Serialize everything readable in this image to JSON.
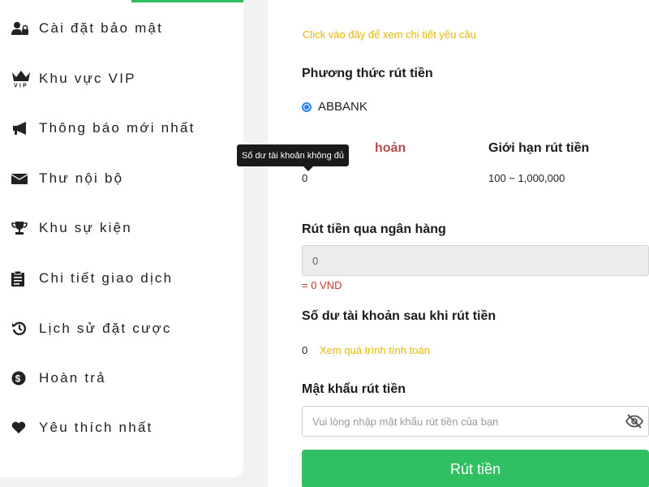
{
  "sidebar": {
    "items": [
      {
        "icon": "user-lock-icon",
        "label": "Cài đặt bảo mật"
      },
      {
        "icon": "vip-crown-icon",
        "label": "Khu vực VIP"
      },
      {
        "icon": "megaphone-icon",
        "label": "Thông báo mới nhất"
      },
      {
        "icon": "envelope-icon",
        "label": "Thư nội bộ"
      },
      {
        "icon": "trophy-icon",
        "label": "Khu sự kiện"
      },
      {
        "icon": "clipboard-icon",
        "label": "Chi tiết giao dịch"
      },
      {
        "icon": "history-icon",
        "label": "Lịch sử đặt cược"
      },
      {
        "icon": "dollar-circle-icon",
        "label": "Hoàn trả"
      },
      {
        "icon": "heart-icon",
        "label": "Yêu thích nhất"
      }
    ]
  },
  "withdraw": {
    "requirements_link": "Click vào đây để xem chi tiết yêu cầu",
    "method_heading": "Phương thức rút tiền",
    "method_selected": "ABBANK",
    "balance_label_partial": "hoản",
    "limit_label": "Giới hạn rút tiền",
    "balance_value": "0",
    "limit_value": "100 ~ 1,000,000",
    "tooltip": "Số dư tài khoản không đủ",
    "bank_heading": "Rút tiền qua ngân hàng",
    "amount_value": "0",
    "amount_vnd": "= 0 VND",
    "after_heading": "Số dư tài khoản sau khi rút tiền",
    "after_value": "0",
    "calc_link": "Xem quá trình tính toán",
    "password_heading": "Mật khẩu rút tiền",
    "password_placeholder": "Vui lòng nhập mật khẩu rút tiền của bạn",
    "submit_label": "Rút tiền"
  },
  "colors": {
    "accent_green": "#31c061",
    "link_yellow": "#e6b800",
    "radio_blue": "#2d7ff0",
    "note_red": "#c0392b"
  }
}
